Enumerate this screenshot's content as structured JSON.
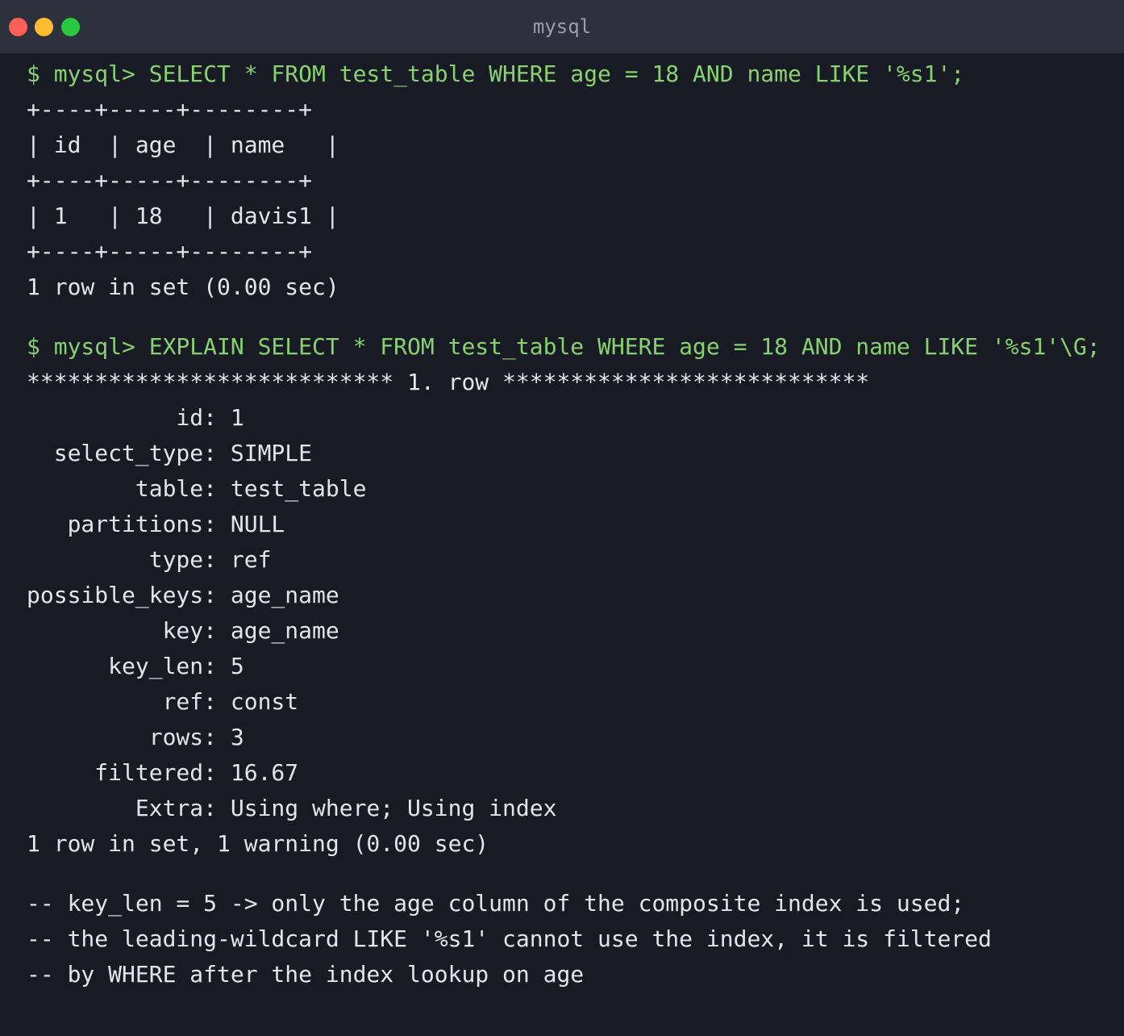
{
  "window": {
    "title": "mysql",
    "buttons": {
      "close_color": "#ff5f57",
      "minimize_color": "#febc2e",
      "maximize_color": "#28c840"
    }
  },
  "colors": {
    "background": "#181b24",
    "titlebar": "#2d313b",
    "command_text": "#86d26f",
    "output_text": "#e3e5ea"
  },
  "terminal": {
    "lines": [
      {
        "type": "cmd",
        "text": "$ mysql> SELECT * FROM test_table WHERE age = 18 AND name LIKE '%s1';"
      },
      {
        "type": "out",
        "text": "+----+-----+--------+"
      },
      {
        "type": "out",
        "text": "| id  | age  | name   |"
      },
      {
        "type": "out",
        "text": "+----+-----+--------+"
      },
      {
        "type": "out",
        "text": "| 1   | 18   | davis1 |"
      },
      {
        "type": "out",
        "text": "+----+-----+--------+"
      },
      {
        "type": "out",
        "text": "1 row in set (0.00 sec)"
      },
      {
        "type": "blank",
        "text": ""
      },
      {
        "type": "cmd",
        "text": "$ mysql> EXPLAIN SELECT * FROM test_table WHERE age = 18 AND name LIKE '%s1'\\G;"
      },
      {
        "type": "out",
        "text": "*************************** 1. row ***************************"
      },
      {
        "type": "out",
        "text": "           id: 1"
      },
      {
        "type": "out",
        "text": "  select_type: SIMPLE"
      },
      {
        "type": "out",
        "text": "        table: test_table"
      },
      {
        "type": "out",
        "text": "   partitions: NULL"
      },
      {
        "type": "out",
        "text": "         type: ref"
      },
      {
        "type": "out",
        "text": "possible_keys: age_name"
      },
      {
        "type": "out",
        "text": "          key: age_name"
      },
      {
        "type": "out",
        "text": "      key_len: 5"
      },
      {
        "type": "out",
        "text": "          ref: const"
      },
      {
        "type": "out",
        "text": "         rows: 3"
      },
      {
        "type": "out",
        "text": "     filtered: 16.67"
      },
      {
        "type": "out",
        "text": "        Extra: Using where; Using index"
      },
      {
        "type": "out",
        "text": "1 row in set, 1 warning (0.00 sec)"
      },
      {
        "type": "blank",
        "text": ""
      },
      {
        "type": "out",
        "text": "-- key_len = 5 -> only the age column of the composite index is used;"
      },
      {
        "type": "out",
        "text": "-- the leading-wildcard LIKE '%s1' cannot use the index, it is filtered"
      },
      {
        "type": "out",
        "text": "-- by WHERE after the index lookup on age"
      }
    ]
  }
}
